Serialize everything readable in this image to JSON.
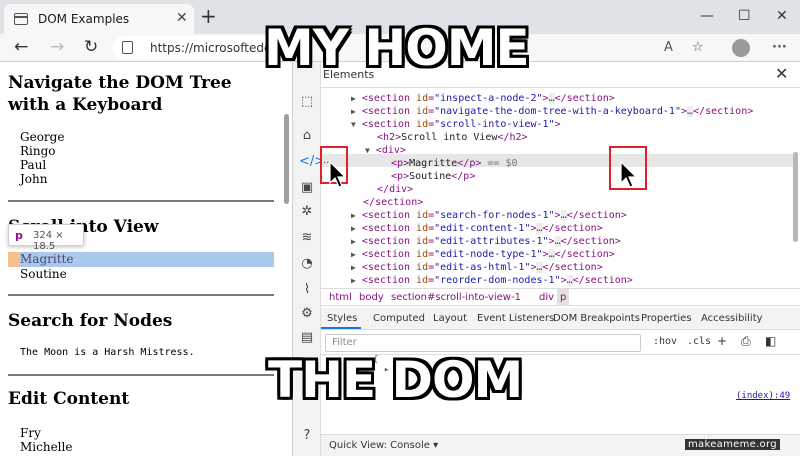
{
  "browser": {
    "tab_title": "DOM Examples",
    "tab_close": "✕",
    "new_tab": "+",
    "url": "https://microsoftedge.g",
    "window_controls": [
      "—",
      "☐",
      "✕"
    ]
  },
  "page": {
    "h1_navigate": "Navigate the DOM Tree with a Keyboard",
    "list1": [
      "George",
      "Ringo",
      "Paul",
      "John"
    ],
    "h1_scroll": "Scroll into View",
    "tooltip_tag": "p",
    "tooltip_dims": "324 × 18.5",
    "magritte": "Magritte",
    "soutine": "Soutine",
    "h1_search": "Search for Nodes",
    "moon": "The Moon is a Harsh Mistress.",
    "h1_edit": "Edit Content",
    "list2": [
      "Fry",
      "Michelle"
    ]
  },
  "devtools": {
    "panel_title": "Elements",
    "close": "✕",
    "dom_lines": [
      {
        "indent": 0,
        "tri": "▶",
        "id": "inspect-a-node-2",
        "collapsed": true
      },
      {
        "indent": 0,
        "tri": "▶",
        "id": "navigate-the-dom-tree-with-a-keyboard-1",
        "collapsed": true
      },
      {
        "indent": 0,
        "tri": "▼",
        "id": "scroll-into-view-1",
        "collapsed": false
      },
      {
        "indent": 1,
        "text": "<h2>Scroll into View</h2>"
      },
      {
        "indent": 1,
        "tri": "▼",
        "text": "<div>"
      },
      {
        "indent": 2,
        "text": "<p>Magritte</p>",
        "suffix": "== $0",
        "selected": true
      },
      {
        "indent": 2,
        "text": "<p>Soutine</p>"
      },
      {
        "indent": 1,
        "text": "</div>"
      },
      {
        "indent": 0,
        "text": "</section>"
      },
      {
        "indent": 0,
        "tri": "▶",
        "id": "search-for-nodes-1",
        "collapsed": true
      },
      {
        "indent": 0,
        "tri": "▶",
        "id": "edit-content-1",
        "collapsed": true
      },
      {
        "indent": 0,
        "tri": "▶",
        "id": "edit-attributes-1",
        "collapsed": true
      },
      {
        "indent": 0,
        "tri": "▶",
        "id": "edit-node-type-1",
        "collapsed": true
      },
      {
        "indent": 0,
        "tri": "▶",
        "id": "edit-as-html-1",
        "collapsed": true
      },
      {
        "indent": 0,
        "tri": "▶",
        "id": "reorder-dom-nodes-1",
        "collapsed": true
      }
    ],
    "dots": "...",
    "breadcrumbs": [
      "html",
      "body",
      "section#scroll-into-view-1",
      "div",
      "p"
    ],
    "style_tabs": [
      "Styles",
      "Computed",
      "Layout",
      "Event Listeners",
      "DOM Breakpoints",
      "Properties",
      "Accessibility"
    ],
    "filter_placeholder": "Filter",
    "hov": ":hov",
    "cls": ".cls",
    "index_link": "(index):49",
    "quick_view": "Quick View:  Console ▾"
  },
  "meme": {
    "top": "MY HOME",
    "bottom": "THE DOM",
    "watermark": "makeameme.org"
  },
  "colors": {
    "highlight": "#a8c8ec",
    "padding": "#f4c18a",
    "red_box": "#e0202a",
    "tag": "#881280",
    "attr_name": "#994500",
    "attr_value": "#1a1aa6"
  }
}
